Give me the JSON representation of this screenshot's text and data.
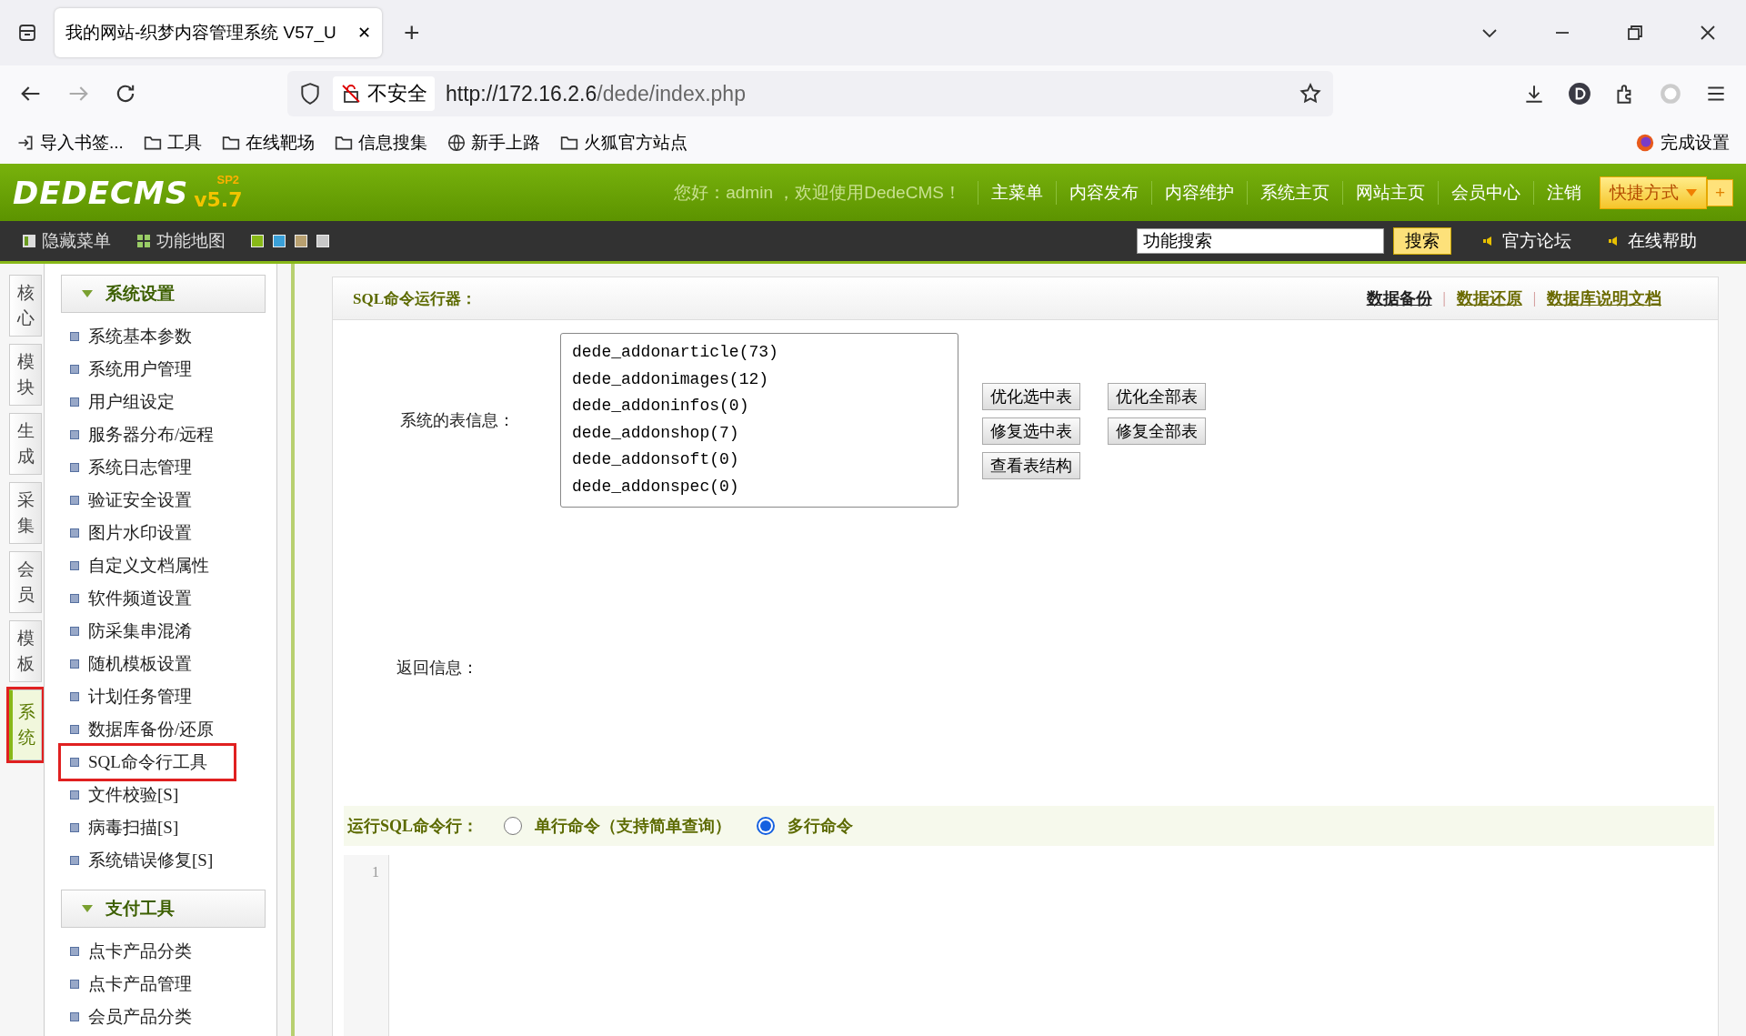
{
  "browser": {
    "tab_title": "我的网站-织梦内容管理系统 V57_U",
    "tab_close": "✕",
    "new_tab": "+",
    "security": "不安全",
    "url_host": "http://172.16.2.6",
    "url_path": "/dede/index.php",
    "bookmarks": [
      {
        "kind": "import",
        "label": "导入书签..."
      },
      {
        "kind": "folder",
        "label": "工具"
      },
      {
        "kind": "folder",
        "label": "在线靶场"
      },
      {
        "kind": "folder",
        "label": "信息搜集"
      },
      {
        "kind": "globe",
        "label": "新手上路"
      },
      {
        "kind": "folder",
        "label": "火狐官方站点"
      }
    ],
    "setup": "完成设置"
  },
  "header": {
    "logo": "DEDECMS",
    "version": "v5.7",
    "edition": "SP2",
    "greeting": "您好：admin ，欢迎使用DedeCMS！",
    "nav": [
      "主菜单",
      "内容发布",
      "内容维护",
      "系统主页",
      "网站主页",
      "会员中心",
      "注销"
    ],
    "shortcut": "快捷方式",
    "shortcut_add": "+"
  },
  "toolbar": {
    "hide_menu": "隐藏菜单",
    "site_map": "功能地图",
    "skins": [
      {
        "color": "#88b818"
      },
      {
        "color": "#3aa0d8"
      },
      {
        "color": "#b8a070"
      },
      {
        "color": "#c8c8c8"
      }
    ],
    "search_value": "功能搜索",
    "search_button": "搜索",
    "links": [
      "官方论坛",
      "在线帮助"
    ]
  },
  "side_tabs": [
    {
      "label": "核心",
      "selected": false,
      "highlighted": false
    },
    {
      "label": "模块",
      "selected": false,
      "highlighted": false
    },
    {
      "label": "生成",
      "selected": false,
      "highlighted": false
    },
    {
      "label": "采集",
      "selected": false,
      "highlighted": false
    },
    {
      "label": "会员",
      "selected": false,
      "highlighted": false
    },
    {
      "label": "模板",
      "selected": false,
      "highlighted": false
    },
    {
      "label": "系统",
      "selected": true,
      "highlighted": true
    }
  ],
  "menu_groups": [
    {
      "title": "系统设置",
      "expanded": true,
      "items": [
        {
          "label": "系统基本参数",
          "highlighted": false
        },
        {
          "label": "系统用户管理",
          "highlighted": false
        },
        {
          "label": "用户组设定",
          "highlighted": false
        },
        {
          "label": "服务器分布/远程",
          "highlighted": false
        },
        {
          "label": "系统日志管理",
          "highlighted": false
        },
        {
          "label": "验证安全设置",
          "highlighted": false
        },
        {
          "label": "图片水印设置",
          "highlighted": false
        },
        {
          "label": "自定义文档属性",
          "highlighted": false
        },
        {
          "label": "软件频道设置",
          "highlighted": false
        },
        {
          "label": "防采集串混淆",
          "highlighted": false
        },
        {
          "label": "随机模板设置",
          "highlighted": false
        },
        {
          "label": "计划任务管理",
          "highlighted": false
        },
        {
          "label": "数据库备份/还原",
          "highlighted": false
        },
        {
          "label": "SQL命令行工具",
          "highlighted": true
        },
        {
          "label": "文件校验[S]",
          "highlighted": false
        },
        {
          "label": "病毒扫描[S]",
          "highlighted": false
        },
        {
          "label": "系统错误修复[S]",
          "highlighted": false
        }
      ]
    },
    {
      "title": "支付工具",
      "expanded": true,
      "items": [
        {
          "label": "点卡产品分类",
          "highlighted": false
        },
        {
          "label": "点卡产品管理",
          "highlighted": false
        },
        {
          "label": "会员产品分类",
          "highlighted": false
        }
      ]
    }
  ],
  "panel": {
    "title": "SQL命令运行器：",
    "links": [
      {
        "label": "数据备份",
        "selected": true
      },
      {
        "label": "数据还原",
        "selected": false
      },
      {
        "label": "数据库说明文档",
        "selected": false
      }
    ],
    "link_separators": [
      "|",
      "|"
    ],
    "tables_label": "系统的表信息：",
    "tables": [
      "dede_addonarticle(73)",
      "dede_addonimages(12)",
      "dede_addoninfos(0)",
      "dede_addonshop(7)",
      "dede_addonsoft(0)",
      "dede_addonspec(0)"
    ],
    "buttons": [
      "优化选中表",
      "优化全部表",
      "修复选中表",
      "修复全部表",
      "查看表结构"
    ],
    "result_label": "返回信息：",
    "run_label": "运行SQL命令行：",
    "modes": [
      {
        "label": "单行命令（支持简单查询）",
        "selected": false
      },
      {
        "label": "多行命令",
        "selected": true
      }
    ],
    "editor_line": "1"
  }
}
